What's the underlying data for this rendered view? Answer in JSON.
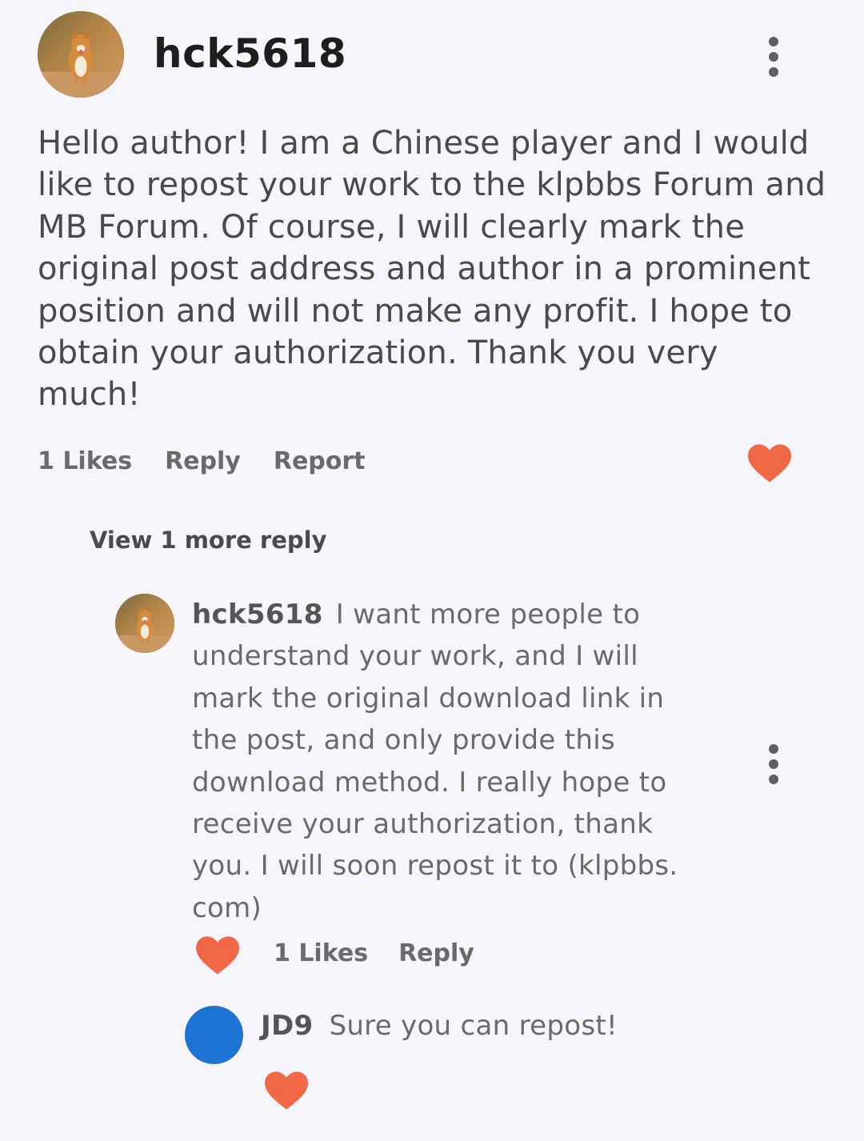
{
  "comment": {
    "username": "hck5618",
    "avatar_icon": "corgi-avatar",
    "body": "Hello author! I am a Chinese player and I would like to repost your work to the klpbbs Forum and MB Forum. Of course, I will clearly mark the original post address and author in a prominent position and will not make any profit. I hope to obtain your authorization. Thank you very much!",
    "likes_label": "1 Likes",
    "reply_label": "Reply",
    "report_label": "Report",
    "heart_color": "#f06845",
    "view_more_label": "View 1 more reply"
  },
  "reply": {
    "username": "hck5618",
    "avatar_icon": "corgi-avatar",
    "body": "I want more people to understand your work, and I will mark the original download link in the post, and only provide this download method. I really hope to receive your authorization, thank you. I will soon repost it to (klpbbs. com)",
    "likes_label": "1 Likes",
    "reply_label": "Reply"
  },
  "nested_reply": {
    "username": "JD9",
    "avatar_color": "#1d74d4",
    "body": "Sure you can repost!"
  }
}
